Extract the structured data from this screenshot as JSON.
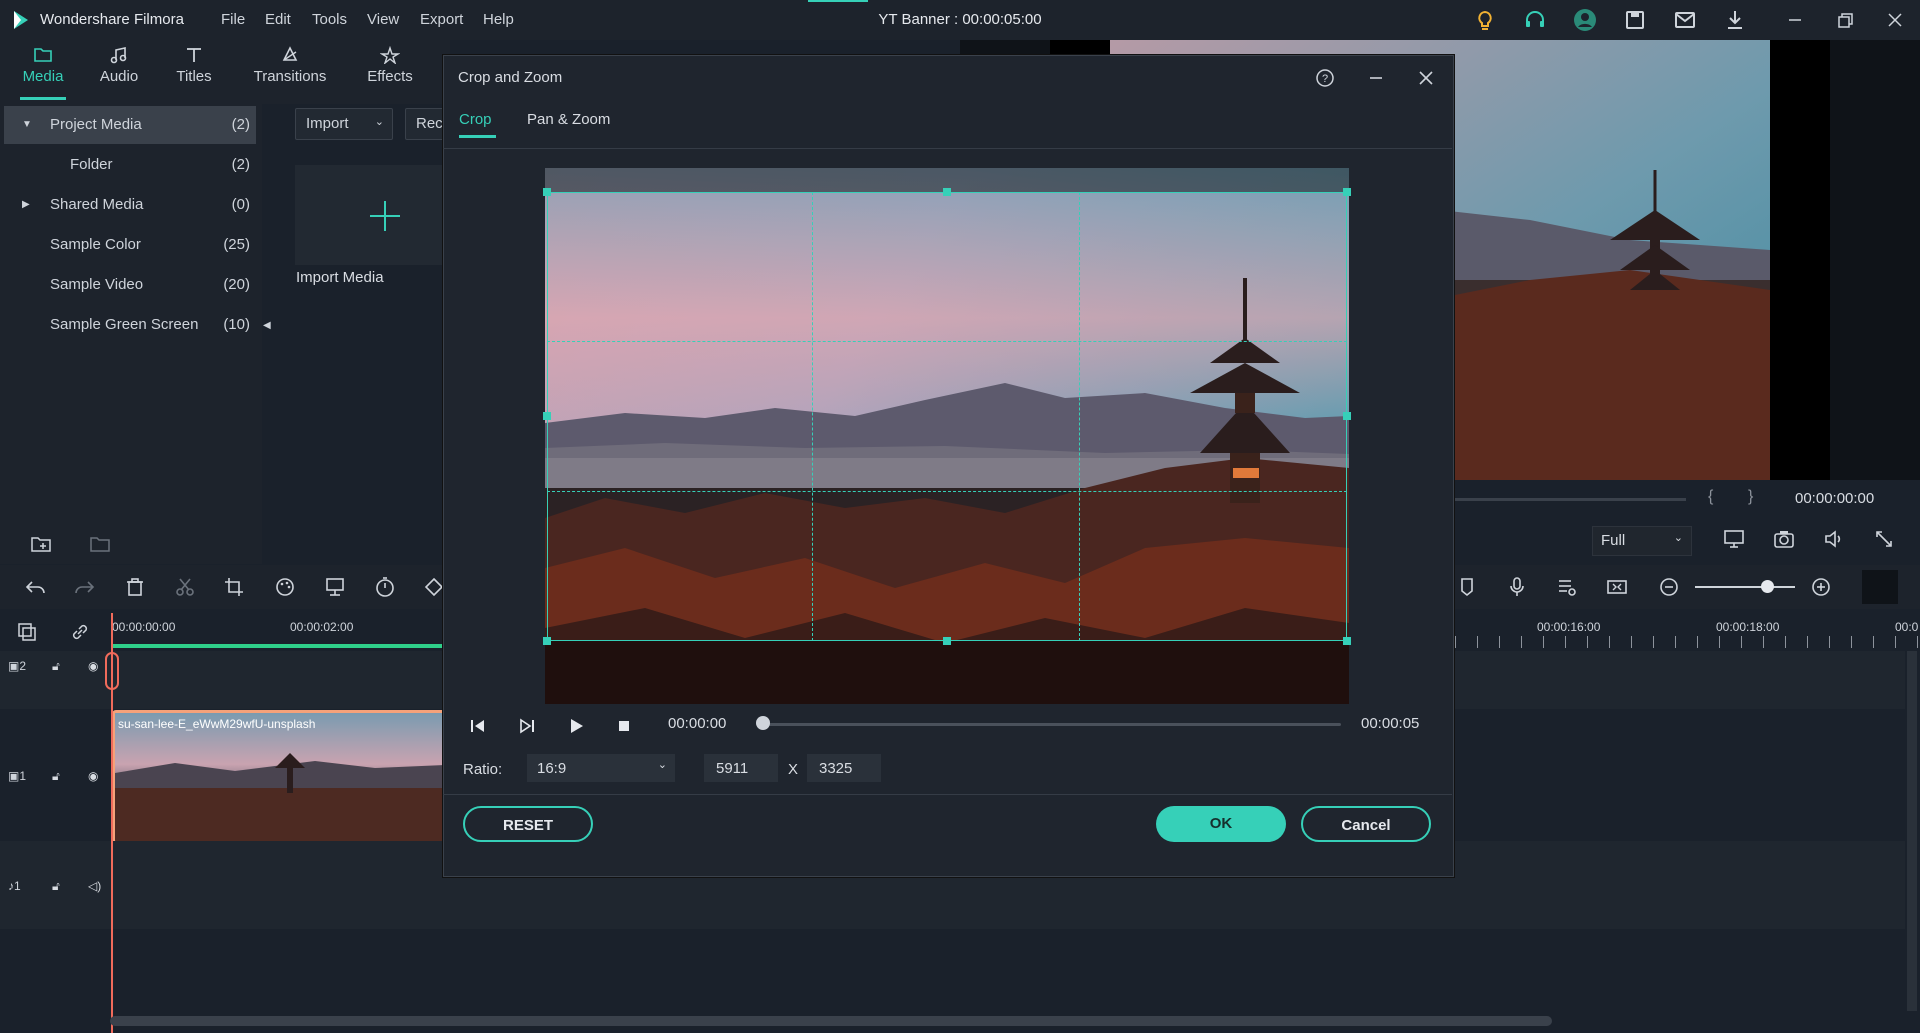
{
  "app": {
    "name": "Wondershare Filmora",
    "window_title": "YT Banner : 00:00:05:00",
    "menu": [
      "File",
      "Edit",
      "Tools",
      "View",
      "Export",
      "Help"
    ]
  },
  "nav_tabs": [
    {
      "label": "Media",
      "icon": "folder-icon"
    },
    {
      "label": "Audio",
      "icon": "music-note-icon"
    },
    {
      "label": "Titles",
      "icon": "text-t-icon"
    },
    {
      "label": "Transitions",
      "icon": "transition-icon"
    },
    {
      "label": "Effects",
      "icon": "effects-icon"
    }
  ],
  "media_tree": [
    {
      "label": "Project Media",
      "count": "(2)",
      "expanded": true
    },
    {
      "label": "Folder",
      "count": "(2)"
    },
    {
      "label": "Shared Media",
      "count": "(0)",
      "expanded": false
    },
    {
      "label": "Sample Color",
      "count": "(25)"
    },
    {
      "label": "Sample Video",
      "count": "(20)"
    },
    {
      "label": "Sample Green Screen",
      "count": "(10)"
    }
  ],
  "media_toolbar": {
    "import_label": "Import",
    "record_label": "Rec",
    "import_tile_label": "Import Media"
  },
  "player": {
    "timecode": "00:00:00:00",
    "quality": "Full"
  },
  "timeline": {
    "ruler_labels": [
      "00:00:00:00",
      "00:00:02:00",
      "00:00:16:00",
      "00:00:18:00",
      "00:0"
    ],
    "tracks": [
      {
        "label": "2",
        "type": "video"
      },
      {
        "label": "1",
        "type": "video"
      },
      {
        "label": "1",
        "type": "audio"
      }
    ],
    "clip_name": "su-san-lee-E_eWwM29wfU-unsplash"
  },
  "dialog": {
    "title": "Crop and Zoom",
    "tabs": [
      "Crop",
      "Pan & Zoom"
    ],
    "active_tab": "Crop",
    "time_start": "00:00:00",
    "time_end": "00:00:05",
    "playback_progress": 0,
    "ratio_label": "Ratio:",
    "ratio_value": "16:9",
    "width": "5911",
    "x_label": "X",
    "height": "3325",
    "reset_label": "RESET",
    "ok_label": "OK",
    "cancel_label": "Cancel"
  },
  "colors": {
    "accent": "#36d0b8",
    "background": "#1a212b",
    "clip_border": "#f4a27a",
    "playhead": "#f06b5b"
  }
}
